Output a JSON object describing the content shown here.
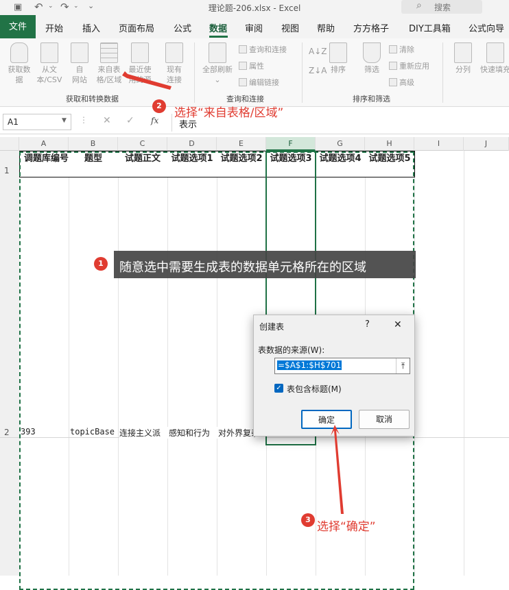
{
  "window": {
    "title": "理论题-206.xlsx - Excel",
    "search_placeholder": "搜索"
  },
  "tabs": {
    "file": "文件",
    "items": [
      "开始",
      "插入",
      "页面布局",
      "公式",
      "数据",
      "审阅",
      "视图",
      "帮助",
      "方方格子",
      "DIY工具箱",
      "公式向导"
    ],
    "active": "数据"
  },
  "ribbon": {
    "get_data": "获取数\n据",
    "from_text_csv": "从文\n本/CSV",
    "from_web": "自\n网站",
    "from_table": "来自表\n格/区域",
    "recent_sources": "最近使\n用的源",
    "existing_connections": "现有\n连接",
    "group_get_transform": "获取和转换数据",
    "refresh_all": "全部刷新",
    "queries_connections": "查询和连接",
    "properties": "属性",
    "edit_links": "编辑链接",
    "group_queries": "查询和连接",
    "sort": "排序",
    "filter": "筛选",
    "clear": "清除",
    "reapply": "重新应用",
    "advanced": "高级",
    "group_sort_filter": "排序和筛选",
    "split": "分列",
    "flash_fill": "快速填充"
  },
  "formula_bar": {
    "name_box": "A1",
    "fx": "fx",
    "content": "表示"
  },
  "columns": [
    "A",
    "B",
    "C",
    "D",
    "E",
    "F",
    "G",
    "H",
    "I",
    "J"
  ],
  "rows": [
    "1",
    "2"
  ],
  "header_row": [
    "调题库编号",
    "题型",
    "试题正文",
    "试题选项1",
    "试题选项2",
    "试题选项3",
    "试题选项4",
    "试题选项5"
  ],
  "data_row": [
    "393",
    "topicBase",
    "连接主义派",
    "感知和行为",
    "对外界复杂",
    "",
    "",
    ""
  ],
  "dialog": {
    "title": "创建表",
    "help": "?",
    "close": "✕",
    "source_label": "表数据的来源(W):",
    "range_value": "=$A$1:$H$701",
    "has_headers_label": "表包含标题(M)",
    "has_headers_checked": true,
    "ok": "确定",
    "cancel": "取消"
  },
  "annotations": {
    "step1_num": "1",
    "step1_text": "随意选中需要生成表的数据单元格所在的区域",
    "step2_num": "2",
    "step2_text": "选择“来自表格/区域”",
    "step3_num": "3",
    "step3_text": "选择“确定”"
  },
  "colors": {
    "excel_green": "#217346",
    "annotation_red": "#e03c31",
    "selection_green": "#1e7145"
  }
}
